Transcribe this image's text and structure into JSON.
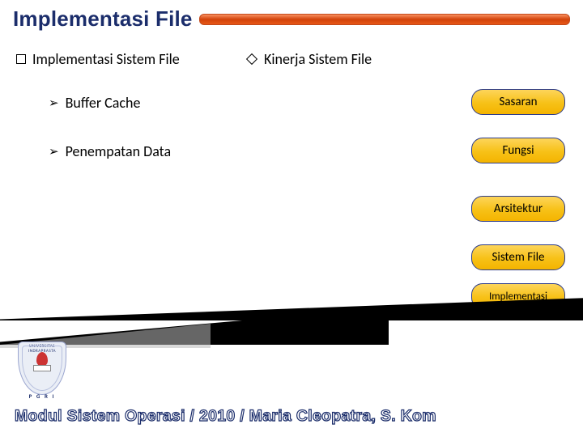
{
  "title": "Implementasi File",
  "columns": {
    "left": "Implementasi Sistem File",
    "right": "Kinerja Sistem File"
  },
  "subitems": {
    "buffer": "Buffer Cache",
    "penempatan": "Penempatan Data"
  },
  "pills": {
    "p1": "Sasaran",
    "p2": "Fungsi",
    "p3": "Arsitektur",
    "p4": "Sistem File",
    "p5": "Implementasi"
  },
  "logo": {
    "org_text": "UNIVERSITAS INDRAPRASTA",
    "bottom": "P G R I"
  },
  "footer": "Modul Sistem Operasi / 2010 / Maria Cleopatra, S. Kom"
}
